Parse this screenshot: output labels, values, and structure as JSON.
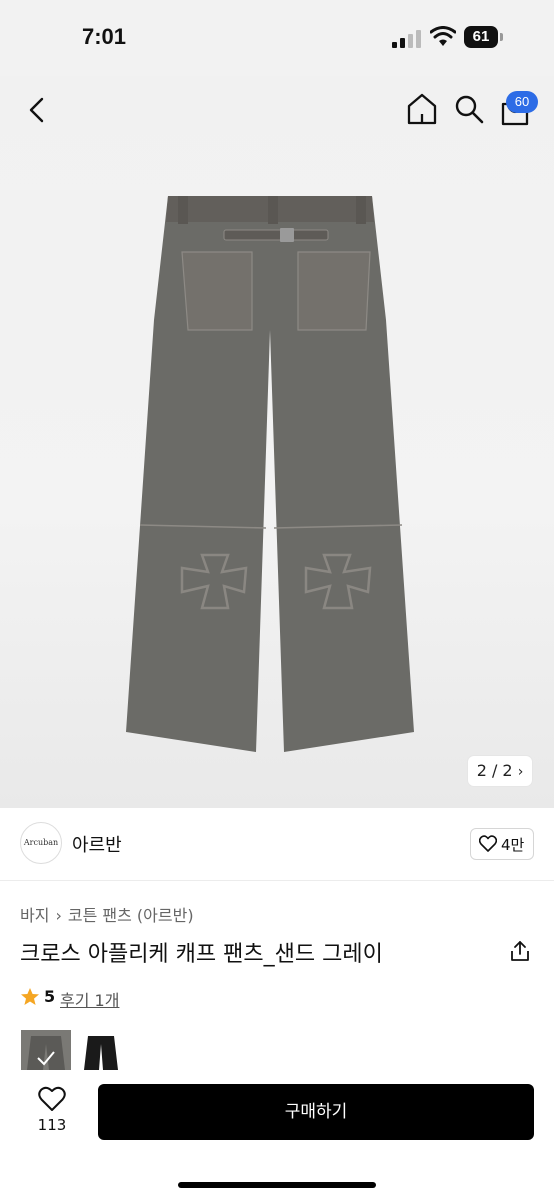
{
  "status_bar": {
    "time": "7:01",
    "battery": "61"
  },
  "nav": {
    "cart_count": "60"
  },
  "gallery": {
    "counter": "2 / 2"
  },
  "brand": {
    "logo_text": "Arcuban",
    "name": "아르반",
    "likes": "4만"
  },
  "breadcrumb": {
    "category": "바지",
    "subcategory": "코튼 팬츠 (아르반)"
  },
  "product": {
    "title": "크로스 아플리케 캐프 팬츠_샌드 그레이",
    "rating": "5",
    "review_label": "후기 1개"
  },
  "bottom": {
    "wish_count": "113",
    "buy_label": "구매하기"
  },
  "colors": {
    "accent": "#2d6ce6",
    "star": "#f5a623",
    "buy_button": "#000000"
  }
}
